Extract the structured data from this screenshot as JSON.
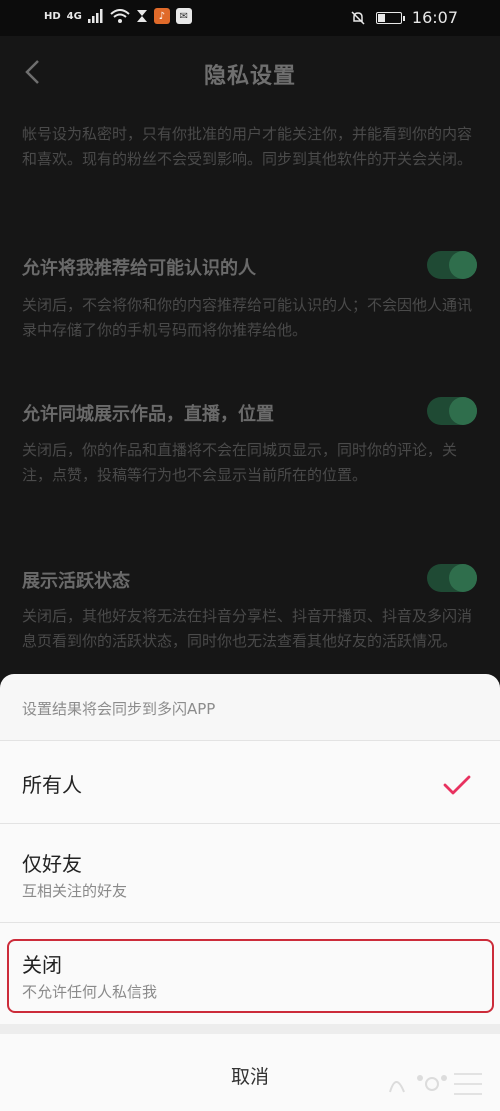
{
  "status_bar": {
    "left_chips": [
      "HD",
      "4G"
    ],
    "time": "16:07",
    "battery_level": 0.3,
    "icons": [
      "signal-icon",
      "wifi-icon",
      "hourglass-icon",
      "notification-app-icon",
      "mute-bell-icon",
      "battery-icon"
    ]
  },
  "header": {
    "title": "隐私设置",
    "back_icon": "chevron-left-icon"
  },
  "settings": {
    "top_desc": "帐号设为私密时，只有你批准的用户才能关注你，并能看到你的内容和喜欢。现有的粉丝不会受到影响。同步到其他软件的开关会关闭。",
    "items": [
      {
        "title": "允许将我推荐给可能认识的人",
        "desc": "关闭后，不会将你和你的内容推荐给可能认识的人；不会因他人通讯录中存储了你的手机号码而将你推荐给他。",
        "enabled": true
      },
      {
        "title": "允许同城展示作品，直播，位置",
        "desc": "关闭后，你的作品和直播将不会在同城页显示，同时你的评论，关注，点赞，投稿等行为也不会显示当前所在的位置。",
        "enabled": true
      },
      {
        "title": "展示活跃状态",
        "desc": "关闭后，其他好友将无法在抖音分享栏、抖音开播页、抖音及多闪消息页看到你的活跃状态，同时你也无法查看其他好友的活跃情况。",
        "enabled": true
      }
    ]
  },
  "sheet": {
    "note": "设置结果将会同步到多闪APP",
    "options": [
      {
        "label": "所有人",
        "sub": "",
        "selected": true
      },
      {
        "label": "仅好友",
        "sub": "互相关注的好友",
        "selected": false
      },
      {
        "label": "关闭",
        "sub": "不允许任何人私信我",
        "selected": false
      }
    ],
    "cancel": "取消"
  },
  "colors": {
    "accent_check": "#e8315f",
    "highlight_border": "#cc2c3a",
    "toggle_on": "#2f6e4c"
  }
}
